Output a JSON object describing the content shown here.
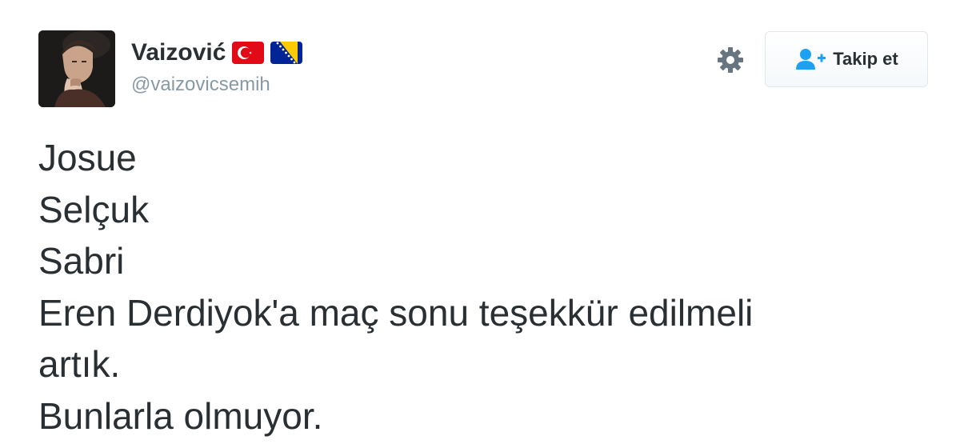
{
  "user": {
    "display_name": "Vaizović",
    "handle": "@vaizovicsemih",
    "flags": [
      "turkey-flag",
      "bosnia-flag"
    ]
  },
  "actions": {
    "follow_label": "Takip et",
    "settings_icon": "gear-icon",
    "follow_icon": "add-user-icon"
  },
  "tweet": {
    "lines": [
      "Josue",
      "Selçuk",
      "Sabri",
      "Eren Derdiyok'a maç sonu teşekkür edilmeli",
      "artık.",
      "Bunlarla olmuyor."
    ]
  },
  "colors": {
    "text": "#292f33",
    "muted": "#8899a6",
    "follow_icon": "#1da1f2",
    "turkey_red": "#e30a17",
    "bosnia_blue": "#002395",
    "bosnia_yellow": "#fecb00"
  }
}
